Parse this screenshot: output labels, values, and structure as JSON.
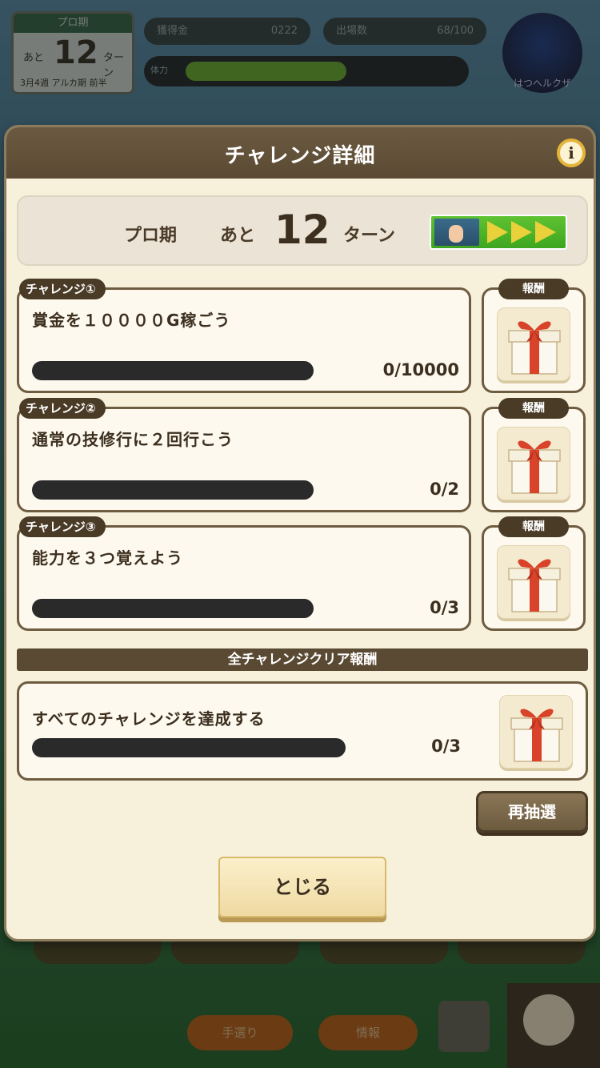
{
  "background_hud": {
    "calendar_header": "プロ期",
    "calendar_prefix": "あと",
    "calendar_turns": "12",
    "calendar_suffix": "ターン",
    "calendar_footer": "3月4週 アルカ期 前半",
    "pill_left_label": "獲得金",
    "pill_left_value": "0222",
    "pill_right_label": "出場数",
    "pill_right_value": "68/100",
    "stamina_label": "体力",
    "stamina_fraction": 0.58,
    "icon_caption": "はつへルクザ"
  },
  "bottom_nav": {
    "tabs": [
      "",
      "",
      "",
      ""
    ],
    "button_left": "手選り",
    "button_right": "情報"
  },
  "modal": {
    "title": "チャレンジ詳細",
    "info_icon_glyph": "i",
    "period_label": "プロ期",
    "remaining_label": "あと",
    "remaining_turns": "12",
    "turn_word": "ターン",
    "reward_tag": "報酬",
    "challenges": [
      {
        "tag": "チャレンジ①",
        "text": "賞金を１００００G稼ごう",
        "count": "0/10000",
        "progress": 0.0
      },
      {
        "tag": "チャレンジ②",
        "text": "通常の技修行に２回行こう",
        "count": "0/2",
        "progress": 0.0
      },
      {
        "tag": "チャレンジ③",
        "text": "能力を３つ覚えよう",
        "count": "0/3",
        "progress": 0.0
      }
    ],
    "all_banner": "全チャレンジクリア報酬",
    "all_challenge": {
      "text": "すべてのチャレンジを達成する",
      "count": "0/3",
      "progress": 0.0
    },
    "redraw_label": "再抽選",
    "close_label": "とじる"
  },
  "colors": {
    "panel_bg": "#f7f1dc",
    "header_brown": "#5b4a33",
    "progress_track": "#2a2a2a",
    "stage_badge_green": "#4fb52a",
    "stage_arrow_yellow": "#e8d13a",
    "gift_red": "#d8432a"
  },
  "icons": {
    "info": "info-icon",
    "gift": "gift-box-icon",
    "stage_arrow": "play-triangle-icon"
  }
}
